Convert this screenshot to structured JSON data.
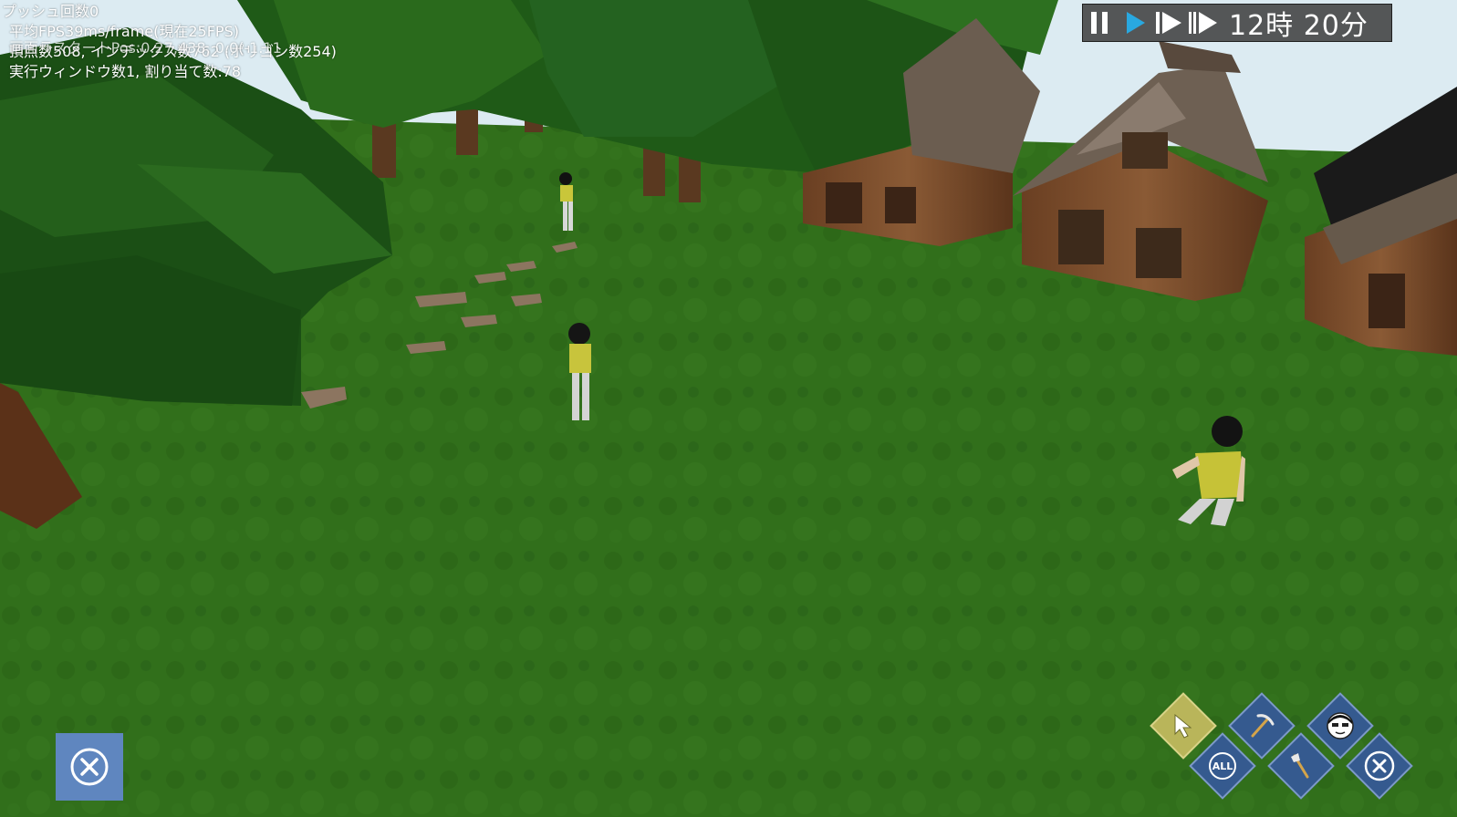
{
  "debug": {
    "push_count": "プッシュ回数0",
    "avg_fps": "平均FPS39ms/frame(現在25FPS)",
    "raycast_pos": "画面ラスタートPos:0.27,438, 0.0(-1.11",
    "vertex_count": "頂点数508, インデックス数762 (ポリゴン数254)",
    "window_count": "実行ウィンドウ数1, 割り当て数:78"
  },
  "time_panel": {
    "time_text": "12時 20分",
    "buttons": [
      "pause-icon",
      "play-icon",
      "fast-forward-icon",
      "fastest-forward-icon"
    ],
    "active_button": "play-icon",
    "accent_color": "#29a8e0"
  },
  "tools": {
    "items": [
      "select-cursor-icon",
      "pickaxe-icon",
      "character-face-icon",
      "all-icon",
      "axe-icon",
      "close-icon"
    ],
    "selected": "select-cursor-icon",
    "all_label": "ALL"
  },
  "close_left": {
    "icon": "close-icon"
  },
  "colors": {
    "grass": "#2f6e19",
    "sky": "#dcebf2",
    "tool_blue": "#355a8f",
    "tool_selected": "#b9b55a",
    "close_bg": "#5f86bf"
  }
}
